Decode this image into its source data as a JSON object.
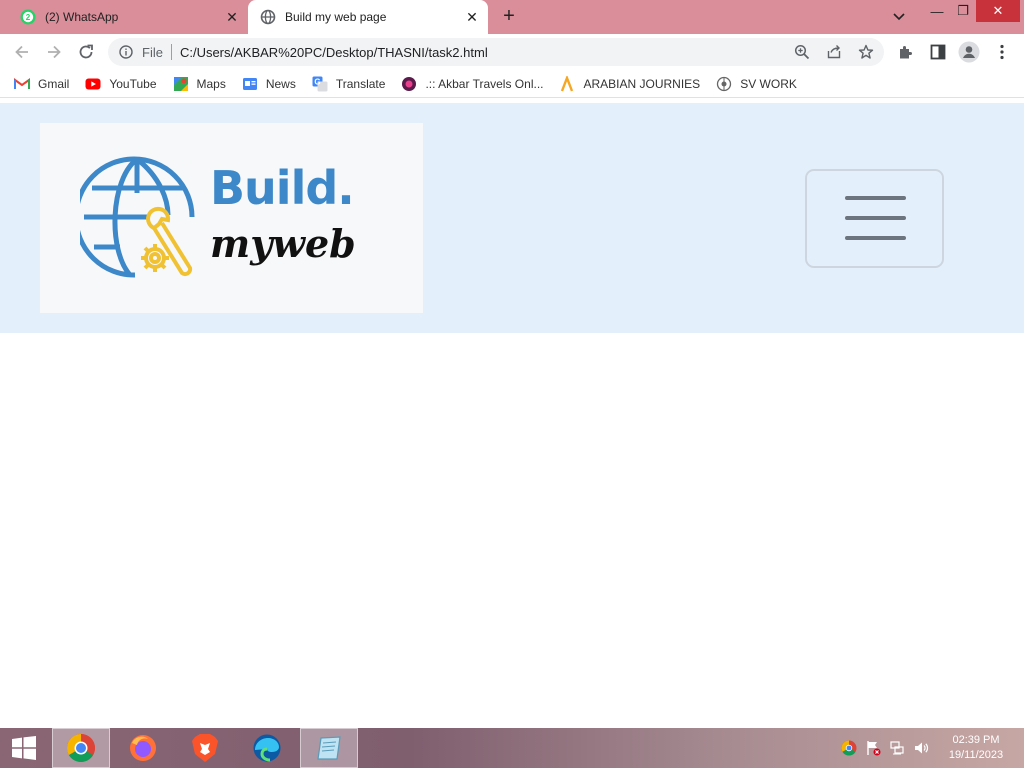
{
  "browser": {
    "tabs": [
      {
        "title": "(2) WhatsApp",
        "badge": "2",
        "active": false
      },
      {
        "title": "Build my web page",
        "active": true
      }
    ],
    "new_tab_symbol": "+",
    "close_symbol": "✕",
    "minimize_symbol": "—",
    "restore_symbol": "❐",
    "tab_search_symbol": "⌄",
    "address": {
      "scheme_label": "File",
      "url": "C:/Users/AKBAR%20PC/Desktop/THASNI/task2.html"
    },
    "bookmarks": [
      {
        "label": "Gmail",
        "icon": "gmail-icon"
      },
      {
        "label": "YouTube",
        "icon": "youtube-icon"
      },
      {
        "label": "Maps",
        "icon": "maps-icon"
      },
      {
        "label": "News",
        "icon": "news-icon"
      },
      {
        "label": "Translate",
        "icon": "translate-icon"
      },
      {
        "label": ".:: Akbar Travels Onl...",
        "icon": "akbar-travels-icon"
      },
      {
        "label": "ARABIAN JOURNIES",
        "icon": "arabian-journies-icon"
      },
      {
        "label": "SV WORK",
        "icon": "sv-work-icon"
      }
    ]
  },
  "page": {
    "logo": {
      "line1": "Build.",
      "line2": "myweb"
    },
    "menu_button": "hamburger-menu"
  },
  "taskbar": {
    "apps": [
      "windows-start",
      "chrome",
      "firefox",
      "brave",
      "edge",
      "notepad"
    ],
    "time": "02:39 PM",
    "date": "19/11/2023"
  },
  "colors": {
    "tabstrip": "#d98e9a",
    "header_band": "#e3f0fb",
    "logo_blue": "#3d88c9",
    "logo_yellow": "#f0c233",
    "taskbar_close": "#c8323a"
  }
}
